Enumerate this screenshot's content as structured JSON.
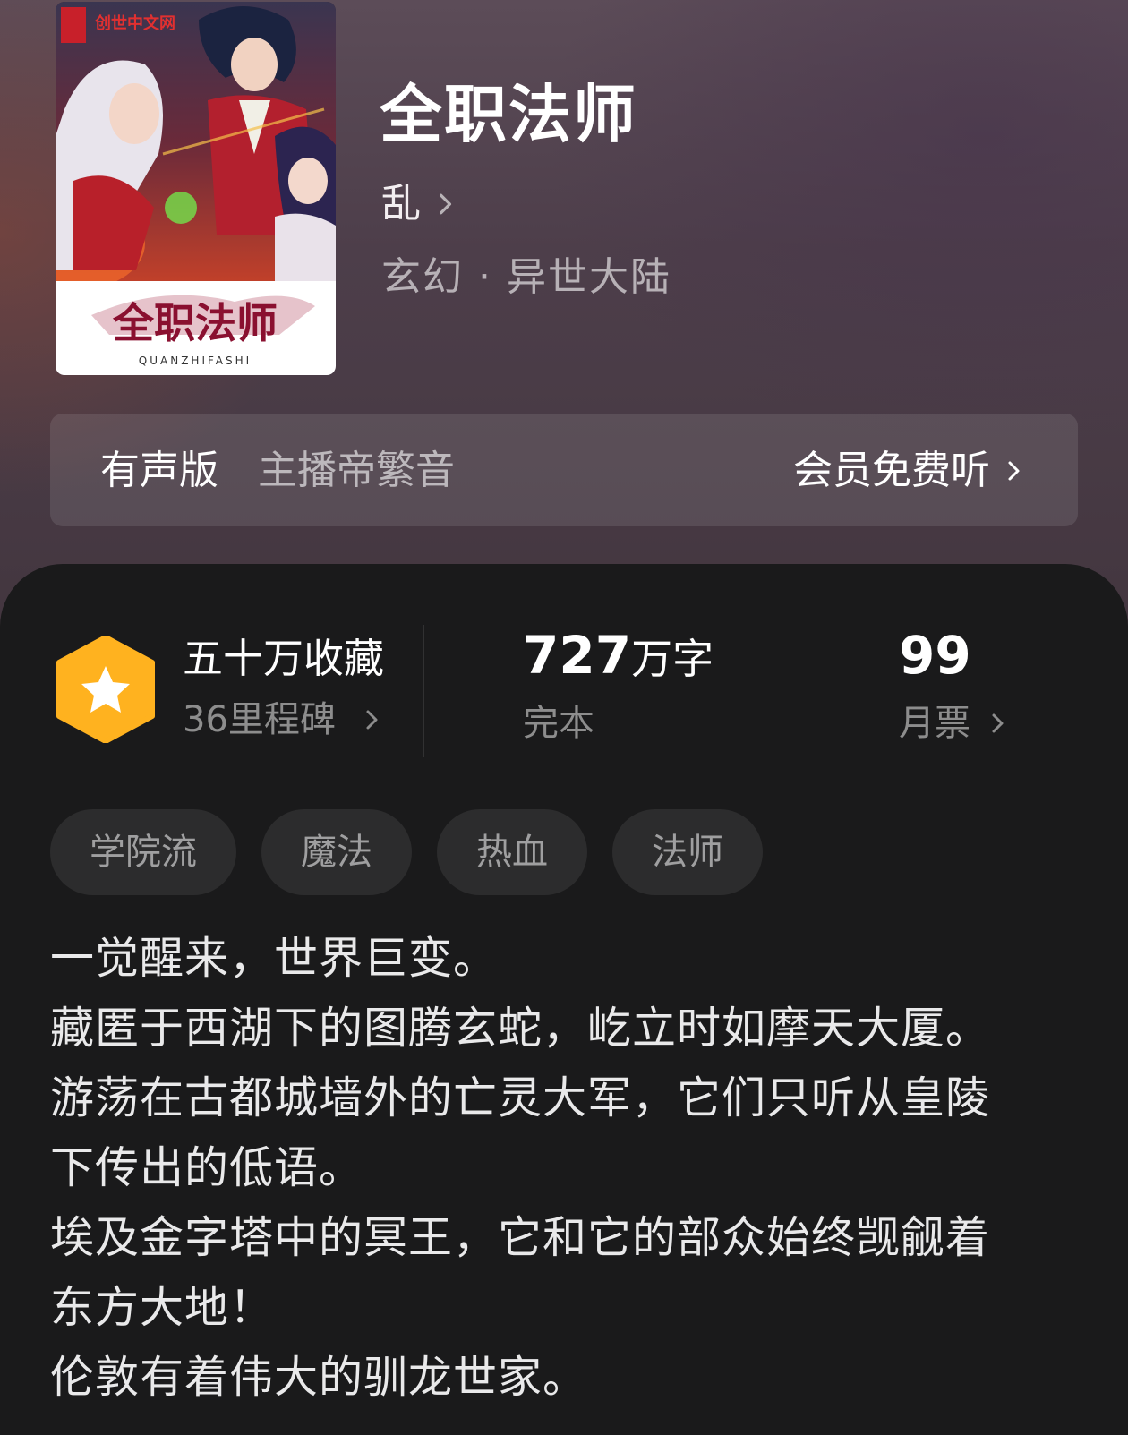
{
  "book": {
    "title": "全职法师",
    "author": "乱",
    "genre": "玄幻 · 异世大陆",
    "cover": {
      "publisher_logo": "创世中文网",
      "cover_title": "全职法师",
      "cover_subtitle": "QUANZHIFASHI"
    }
  },
  "audio": {
    "label": "有声版",
    "host": "主播帝繁音",
    "vip_action": "会员免费听"
  },
  "stats": {
    "favorites": {
      "title": "五十万收藏",
      "milestones": "36里程碑",
      "icon": "star-badge-icon",
      "badge_color": "#ffb21f"
    },
    "words": {
      "number": "727",
      "unit": "万字",
      "status": "完本"
    },
    "monthly_ticket": {
      "number": "99",
      "label": "月票"
    }
  },
  "tags": [
    "学院流",
    "魔法",
    "热血",
    "法师"
  ],
  "description": [
    "一觉醒来，世界巨变。",
    "藏匿于西湖下的图腾玄蛇，屹立时如摩天大厦。",
    "游荡在古都城墙外的亡灵大军，它们只听从皇陵",
    "下传出的低语。",
    "埃及金字塔中的冥王，它和它的部众始终觊觎着",
    "东方大地！",
    "伦敦有着伟大的驯龙世家。"
  ]
}
